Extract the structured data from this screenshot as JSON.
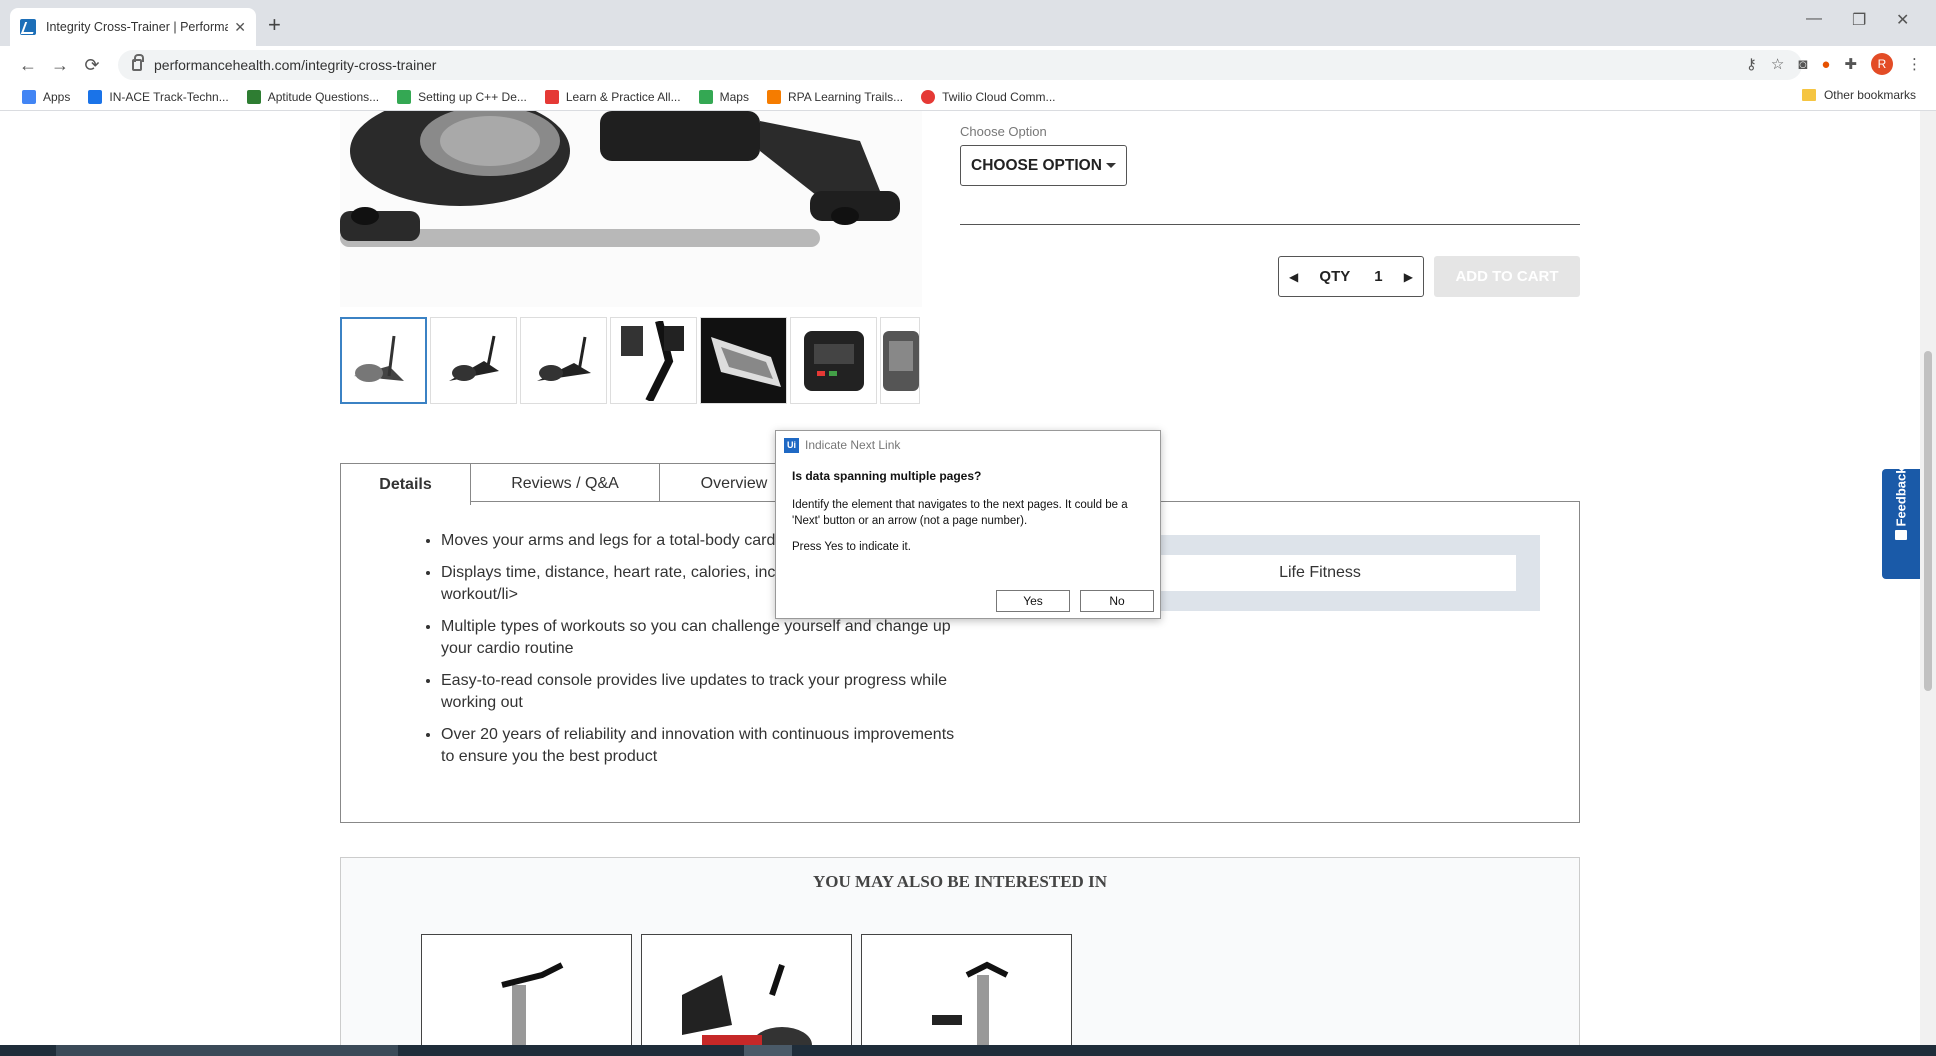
{
  "browser": {
    "tab_title": "Integrity Cross-Trainer | Performa...",
    "tab_close": "✕",
    "new_tab": "+",
    "url": "performancehealth.com/integrity-cross-trainer",
    "back": "←",
    "forward": "→",
    "reload": "⟳",
    "win_min": "—",
    "win_restore": "❐",
    "win_close": "✕",
    "avatar_letter": "R",
    "menu": "⋮"
  },
  "bookmarks": {
    "items": [
      {
        "label": "Apps",
        "color": "#4285f4"
      },
      {
        "label": "IN-ACE Track-Techn...",
        "color": "#1a73e8"
      },
      {
        "label": "Aptitude Questions...",
        "color": "#2e7d32"
      },
      {
        "label": "Setting up C++ De...",
        "color": "#34a853"
      },
      {
        "label": "Learn & Practice All...",
        "color": "#e53935"
      },
      {
        "label": "Maps",
        "color": "#34a853"
      },
      {
        "label": "RPA Learning Trails...",
        "color": "#f57c00"
      },
      {
        "label": "Twilio Cloud Comm...",
        "color": "#e53935"
      }
    ],
    "other": "Other bookmarks"
  },
  "product": {
    "choose_label": "Choose Option",
    "choose_button": "CHOOSE OPTION",
    "qty_label": "QTY",
    "qty_value": "1",
    "add_to_cart": "ADD TO CART",
    "tabs": [
      "Details",
      "Reviews / Q&A",
      "Overview"
    ],
    "details": [
      "Moves your arms and legs for a total-body cardio",
      "Displays time, distance, heart rate, calories, inclin resistance of your workout/li>",
      "Multiple types of workouts so you can challenge yourself and change up your cardio routine",
      "Easy-to-read console provides live updates to track your progress while working out",
      "Over 20 years of reliability and innovation with continuous improvements to ensure you the best product"
    ],
    "brand": "Life Fitness"
  },
  "related": {
    "title": "YOU MAY ALSO BE INTERESTED IN",
    "prev": "‹",
    "next": "›"
  },
  "feedback": {
    "label": "Feedback"
  },
  "dialog": {
    "title": "Indicate Next Link",
    "icon_text": "Ui",
    "question": "Is data spanning multiple pages?",
    "body": "Identify the element that navigates to the next pages. It could be a 'Next' button or an arrow (not a page number).",
    "hint": "Press Yes to indicate it.",
    "yes": "Yes",
    "no": "No"
  },
  "colors": {
    "accent": "#1a5aa8",
    "dialog_icon": "#1f69c4",
    "thumb_active": "#3b82c4"
  }
}
